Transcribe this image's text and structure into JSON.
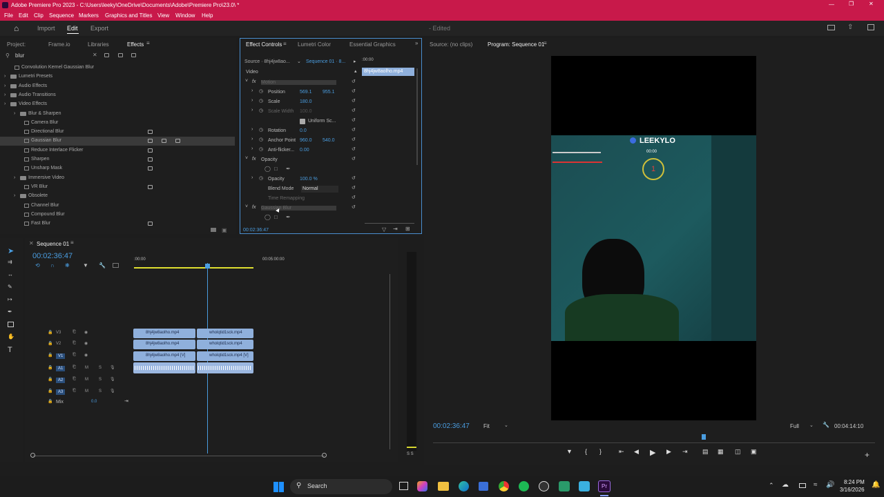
{
  "title": "Adobe Premiere Pro 2023 - C:\\Users\\leeky\\OneDrive\\Documents\\Adobe\\Premiere Pro\\23.0\\ *",
  "menu": [
    "File",
    "Edit",
    "Clip",
    "Sequence",
    "Markers",
    "Graphics and Titles",
    "View",
    "Window",
    "Help"
  ],
  "workspace": {
    "import": "Import",
    "edit": "Edit",
    "export": "Export",
    "status": "- Edited"
  },
  "effects_panel": {
    "tabs": [
      "Project:",
      "Frame.io",
      "Libraries",
      "Effects"
    ],
    "search": "blur",
    "rows": [
      "Convolution Kernel Gaussian Blur",
      "Lumetri Presets",
      "Audio Effects",
      "Audio Transitions",
      "Video Effects",
      "Blur & Sharpen",
      "Camera Blur",
      "Directional Blur",
      "Gaussian Blur",
      "Reduce Interlace Flicker",
      "Sharpen",
      "Unsharp Mask",
      "Immersive Video",
      "VR Blur",
      "Obsolete",
      "Channel Blur",
      "Compound Blur",
      "Fast Blur"
    ]
  },
  "effect_controls": {
    "tabs": [
      "Effect Controls",
      "Lumetri Color",
      "Essential Graphics"
    ],
    "source": "Source · 8hj4jw8ao...",
    "sequence": "Sequence 01 · 8...",
    "time_ruler": ":00:00",
    "clip_label": "8hj4jw8aolho.mp4",
    "video": "Video",
    "motion": "Motion",
    "position": "Position",
    "pos_x": "569.1",
    "pos_y": "955.1",
    "scale": "Scale",
    "scale_v": "180.0",
    "scale_width": "Scale Width",
    "scale_width_v": "100.0",
    "uniform": "Uniform Sc...",
    "rotation": "Rotation",
    "rotation_v": "0.0",
    "anchor": "Anchor Point",
    "anchor_x": "960.0",
    "anchor_y": "540.0",
    "antiflicker": "Anti-flicker...",
    "antiflicker_v": "0.00",
    "opacity": "Opacity",
    "opacity_label": "Opacity",
    "opacity_v": "100.0 %",
    "blend": "Blend Mode",
    "blend_v": "Normal",
    "time_remap": "Time Remapping",
    "gaussian": "Gaussian Blur",
    "timecode": "00:02:36:47"
  },
  "program": {
    "source_tab": "Source: (no clips)",
    "program_tab": "Program: Sequence 01",
    "overlay_name": "LEEKYLO",
    "overlay_time": "00:00",
    "badge": "1",
    "timecode": "00:02:36:47",
    "fit": "Fit",
    "full": "Full",
    "duration": "00:04:14:10"
  },
  "timeline": {
    "tab": "Sequence 01",
    "timecode": "00:02:36:47",
    "ruler_start": ":00:00",
    "ruler_mid": "00:05:00:00",
    "tracks": [
      {
        "id": "V3",
        "clipA": "8hj4jw8aolho.mp4",
        "clipB": "wholqtid1sck.mp4"
      },
      {
        "id": "V2",
        "clipA": "8hj4jw8aolho.mp4",
        "clipB": "wholqtid1sck.mp4"
      },
      {
        "id": "V1",
        "clipA": "8hj4jw8aolho.mp4 [V]",
        "clipB": "wholqtid1sck.mp4 [V]"
      }
    ],
    "audio": [
      "A1",
      "A2",
      "A3"
    ],
    "mix": "Mix",
    "mix_v": "0.0",
    "meter_label": "S S"
  },
  "taskbar": {
    "search": "Search",
    "time": "8:24 PM",
    "date": "3/16/2026"
  },
  "colors": {
    "accent": "#c8194a",
    "blue": "#4a9de0",
    "clip": "#8fb0dc",
    "teal": "#1e4f52"
  }
}
